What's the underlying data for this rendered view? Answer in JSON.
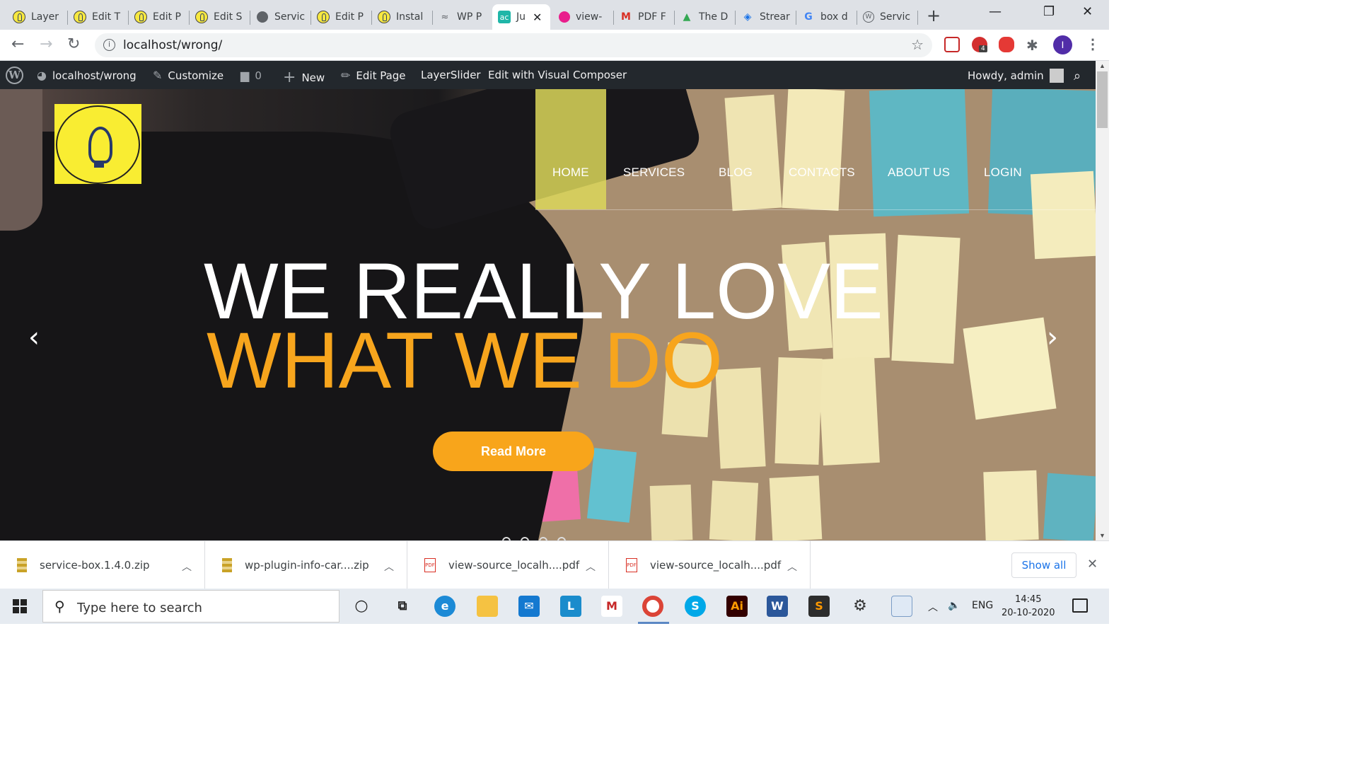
{
  "browser": {
    "tabs": [
      {
        "title": "Layer",
        "favicon": "bulb-icon"
      },
      {
        "title": "Edit T",
        "favicon": "bulb-icon"
      },
      {
        "title": "Edit P",
        "favicon": "bulb-icon"
      },
      {
        "title": "Edit S",
        "favicon": "bulb-icon"
      },
      {
        "title": "Servic",
        "favicon": "globe-icon"
      },
      {
        "title": "Edit P",
        "favicon": "bulb-icon"
      },
      {
        "title": "Instal",
        "favicon": "bulb-icon"
      },
      {
        "title": "WP P",
        "favicon": "plugin-icon"
      },
      {
        "title": "Ju",
        "favicon": "ac-icon",
        "active": true
      },
      {
        "title": "view-",
        "favicon": "view-icon"
      },
      {
        "title": "PDF F",
        "favicon": "gmail-icon"
      },
      {
        "title": "The D",
        "favicon": "drive-icon"
      },
      {
        "title": "Strear",
        "favicon": "stream-icon"
      },
      {
        "title": "box d",
        "favicon": "google-icon"
      },
      {
        "title": "Servic",
        "favicon": "wordpress-icon"
      }
    ],
    "new_tab": "+",
    "url": "localhost/wrong/",
    "profile_initial": "I",
    "ext_badge": "4"
  },
  "admin_bar": {
    "site": "localhost/wrong",
    "customize": "Customize",
    "comments": "0",
    "new": "New",
    "edit_page": "Edit Page",
    "layerslider": "LayerSlider",
    "visual_composer": "Edit with Visual Composer",
    "howdy": "Howdy, admin"
  },
  "site": {
    "menu": [
      "HOME",
      "SERVICES",
      "BLOG",
      "CONTACTS",
      "ABOUT US",
      "LOGIN"
    ],
    "headline_line1": "WE REALLY LOVE",
    "headline_line2": "WHAT WE DO",
    "cta": "Read More",
    "accent_color": "#f7a51d"
  },
  "downloads": {
    "items": [
      {
        "name": "service-box.1.4.0.zip",
        "type": "zip"
      },
      {
        "name": "wp-plugin-info-car....zip",
        "type": "zip"
      },
      {
        "name": "view-source_localh....pdf",
        "type": "pdf"
      },
      {
        "name": "view-source_localh....pdf",
        "type": "pdf"
      }
    ],
    "show_all": "Show all"
  },
  "taskbar": {
    "search_placeholder": "Type here to search",
    "language": "ENG",
    "time": "14:45",
    "date": "20-10-2020"
  }
}
